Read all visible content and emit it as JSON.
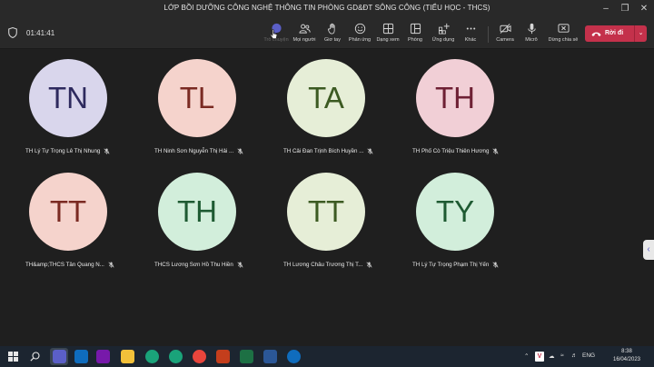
{
  "window": {
    "title": "LỚP BỒI DƯỠNG CÔNG NGHỆ THÔNG TIN PHÒNG GD&ĐT SÔNG CÔNG (TIỂU HỌC - THCS)"
  },
  "meeting": {
    "elapsed": "01:41:41"
  },
  "toolbar": {
    "chat_label": "Trò chuyện",
    "people_label": "Mọi người",
    "raise_label": "Giơ tay",
    "react_label": "Phản ứng",
    "view_label": "Dạng xem",
    "rooms_label": "Phòng",
    "apps_label": "Ứng dụng",
    "more_label": "Khác",
    "camera_label": "Camera",
    "mic_label": "Micrô",
    "share_label": "Dừng chia sẻ",
    "leave_label": "Rời đi"
  },
  "participants": [
    {
      "initials": "TN",
      "name": "TH Lý Tự Trọng Lê Thị Nhung",
      "bg": "#d9d6ec",
      "fg": "#2e2a5e"
    },
    {
      "initials": "TL",
      "name": "TH Ninh Sơn Nguyễn Thị Hải ...",
      "bg": "#f5d3cc",
      "fg": "#7a2a22"
    },
    {
      "initials": "TA",
      "name": "TH Cải Đan Trịnh Bích Huyền ...",
      "bg": "#e6eed7",
      "fg": "#3c5a22"
    },
    {
      "initials": "TH",
      "name": "TH Phố Cò Triệu Thiên Hương",
      "bg": "#f1cfd6",
      "fg": "#6e2034"
    },
    {
      "initials": "TT",
      "name": "TH&amp;THCS Tân Quang N...",
      "bg": "#f5d3cc",
      "fg": "#7a2a22"
    },
    {
      "initials": "TH",
      "name": "THCS Lương Sơn Hồ Thu Hiền",
      "bg": "#d2eedb",
      "fg": "#1e5a32"
    },
    {
      "initials": "TT",
      "name": "TH Lương Châu Trương Thị T...",
      "bg": "#e6eed7",
      "fg": "#3c5a22"
    },
    {
      "initials": "TY",
      "name": "TH Lý Tự Trọng Phạm Thị Yến",
      "bg": "#d2eedb",
      "fg": "#1e5a32"
    }
  ],
  "taskbar": {
    "lang": "ENG",
    "time": "8:38",
    "date": "16/04/2023",
    "app_colors": {
      "teams": "#5b5fc7",
      "outlook": "#0f6cbd",
      "onenote": "#7719aa",
      "explorer": "#f3c13a",
      "edge": "#1aa37a",
      "chrome": "#e8453c",
      "powerpoint": "#c43e1c",
      "excel": "#1d7044",
      "word": "#2b5797"
    }
  }
}
